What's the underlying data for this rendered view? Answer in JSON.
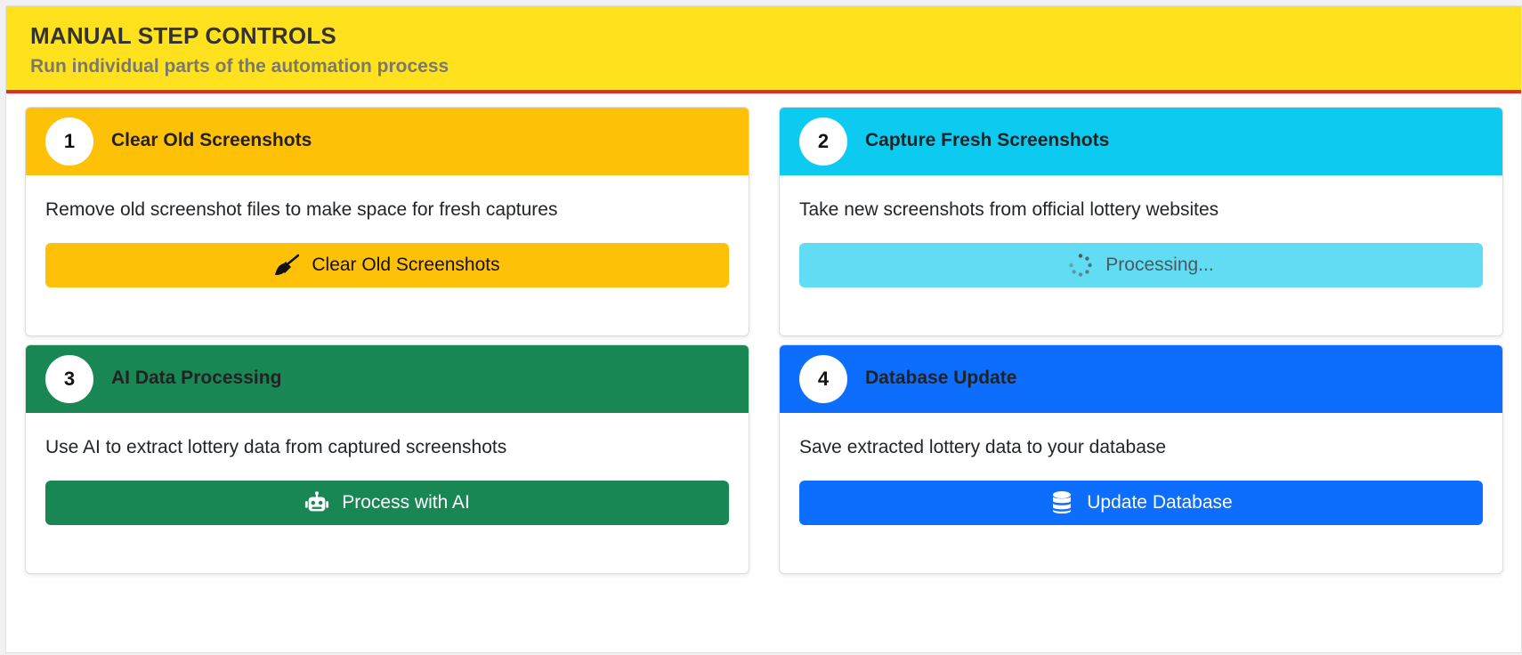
{
  "header": {
    "title": "MANUAL STEP CONTROLS",
    "subtitle": "Run individual parts of the automation process"
  },
  "colors": {
    "header_bg": "#ffe11e",
    "header_border": "#dc3030",
    "step1": "#ffc107",
    "step2": "#0dcaf0",
    "step2_button_disabled": "#61dcf3",
    "step3": "#198754",
    "step4": "#0d6efd"
  },
  "steps": [
    {
      "number": "1",
      "title": "Clear Old Screenshots",
      "description": "Remove old screenshot files to make space for fresh captures",
      "button_label": "Clear Old Screenshots",
      "button_icon": "broom-icon",
      "button_state": "enabled"
    },
    {
      "number": "2",
      "title": "Capture Fresh Screenshots",
      "description": "Take new screenshots from official lottery websites",
      "button_label": "Processing...",
      "button_icon": "spinner-icon",
      "button_state": "disabled"
    },
    {
      "number": "3",
      "title": "AI Data Processing",
      "description": "Use AI to extract lottery data from captured screenshots",
      "button_label": "Process with AI",
      "button_icon": "robot-icon",
      "button_state": "enabled"
    },
    {
      "number": "4",
      "title": "Database Update",
      "description": "Save extracted lottery data to your database",
      "button_label": "Update Database",
      "button_icon": "database-icon",
      "button_state": "enabled"
    }
  ]
}
